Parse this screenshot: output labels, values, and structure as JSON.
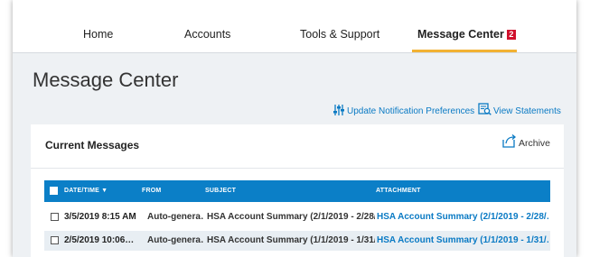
{
  "nav": {
    "items": [
      {
        "label": "Home"
      },
      {
        "label": "Accounts"
      },
      {
        "label": "Tools & Support"
      },
      {
        "label": "Message Center",
        "badge": "2"
      }
    ]
  },
  "page": {
    "title": "Message Center"
  },
  "actions": {
    "update_prefs": "Update Notification Preferences",
    "view_statements": "View Statements"
  },
  "panel": {
    "title": "Current Messages",
    "archive": "Archive"
  },
  "table": {
    "columns": {
      "date": "DATE/TIME",
      "sort": "▼",
      "from": "FROM",
      "subject": "SUBJECT",
      "attachment": "ATTACHMENT"
    },
    "rows": [
      {
        "date": "3/5/2019 8:15 AM",
        "from": "Auto-genera…",
        "subject": "HSA Account Summary (2/1/2019 - 2/28/…",
        "attachment": "HSA Account Summary (2/1/2019 - 2/28/…"
      },
      {
        "date": "2/5/2019 10:06…",
        "from": "Auto-genera…",
        "subject": "HSA Account Summary (1/1/2019 - 1/31/…",
        "attachment": "HSA Account Summary (1/1/2019 - 1/31/…"
      }
    ]
  },
  "colors": {
    "accent": "#0b7fc7",
    "link": "#0a7ac4",
    "badge": "#d0102c",
    "active_underline": "#f2b233"
  },
  "icons": {
    "update_prefs": "sliders-icon",
    "view_statements": "statement-search-icon",
    "archive": "archive-arrow-icon"
  }
}
